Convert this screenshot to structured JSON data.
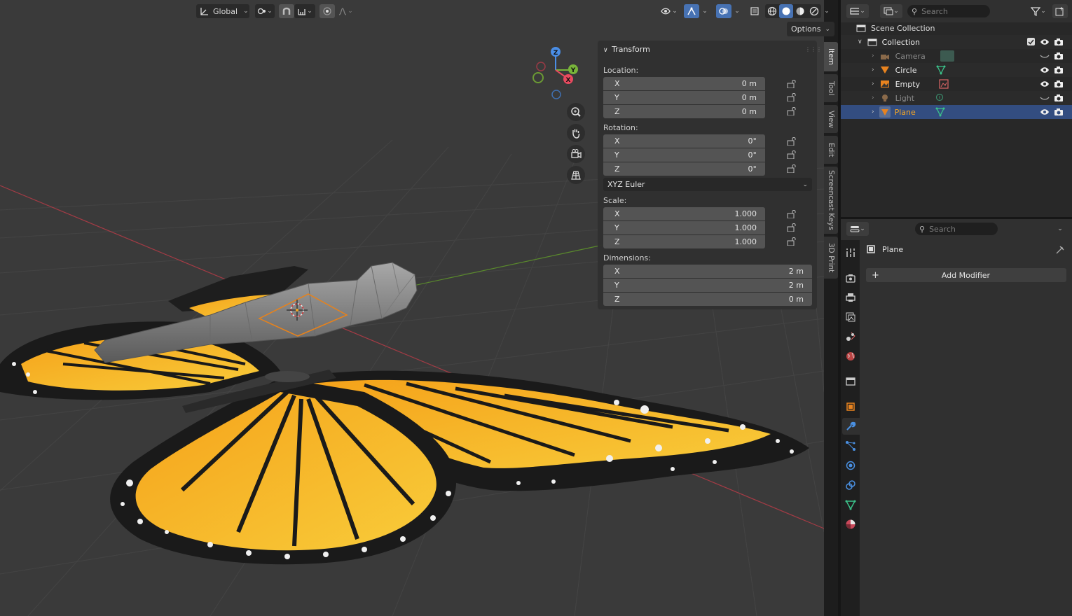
{
  "header": {
    "transform_orientation": "Global",
    "options_label": "Options"
  },
  "npanel": {
    "title": "Transform",
    "location_label": "Location:",
    "location": [
      {
        "axis": "X",
        "value": "0 m"
      },
      {
        "axis": "Y",
        "value": "0 m"
      },
      {
        "axis": "Z",
        "value": "0 m"
      }
    ],
    "rotation_label": "Rotation:",
    "rotation": [
      {
        "axis": "X",
        "value": "0°"
      },
      {
        "axis": "Y",
        "value": "0°"
      },
      {
        "axis": "Z",
        "value": "0°"
      }
    ],
    "rotation_mode": "XYZ Euler",
    "scale_label": "Scale:",
    "scale": [
      {
        "axis": "X",
        "value": "1.000"
      },
      {
        "axis": "Y",
        "value": "1.000"
      },
      {
        "axis": "Z",
        "value": "1.000"
      }
    ],
    "dimensions_label": "Dimensions:",
    "dimensions": [
      {
        "axis": "X",
        "value": "2 m"
      },
      {
        "axis": "Y",
        "value": "2 m"
      },
      {
        "axis": "Z",
        "value": "0 m"
      }
    ]
  },
  "side_tabs": [
    "Item",
    "Tool",
    "View",
    "Edit",
    "Screencast Keys",
    "3D Print"
  ],
  "gizmo": {
    "x": "X",
    "y": "Y",
    "z": "Z"
  },
  "outliner": {
    "search_placeholder": "Search",
    "scene_collection": "Scene Collection",
    "collection": "Collection",
    "items": [
      {
        "name": "Camera",
        "dim": true
      },
      {
        "name": "Circle",
        "dim": false
      },
      {
        "name": "Empty",
        "dim": false
      },
      {
        "name": "Light",
        "dim": true
      },
      {
        "name": "Plane",
        "dim": false,
        "selected": true
      }
    ]
  },
  "properties": {
    "search_placeholder": "Search",
    "object_name": "Plane",
    "add_modifier_label": "Add Modifier"
  },
  "colors": {
    "accent": "#4772b3",
    "selected_row": "#334d80",
    "active_name": "#f5a623"
  }
}
